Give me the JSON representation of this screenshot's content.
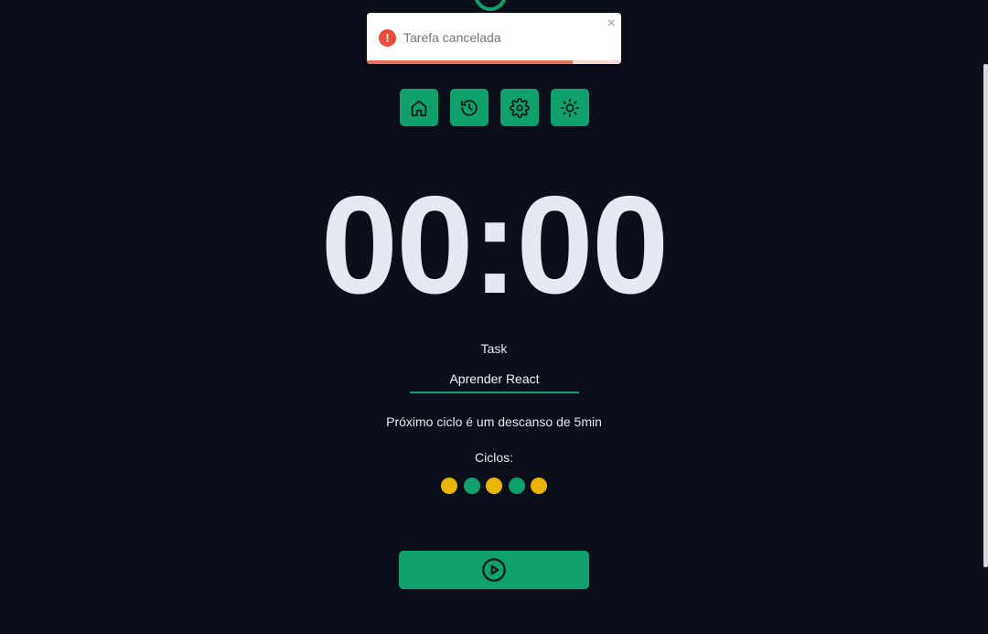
{
  "toast": {
    "message": "Tarefa cancelada",
    "close_symbol": "×",
    "icon": "error-icon",
    "icon_symbol": "!",
    "progress": 0.81,
    "color": "#e74c3c"
  },
  "nav": {
    "items": [
      {
        "name": "home",
        "icon": "home-icon"
      },
      {
        "name": "history",
        "icon": "history-icon"
      },
      {
        "name": "settings",
        "icon": "gear-icon"
      },
      {
        "name": "theme",
        "icon": "sun-icon"
      }
    ]
  },
  "timer": {
    "display": "00:00"
  },
  "task": {
    "label": "Task",
    "value": "Aprender React"
  },
  "next_cycle_text": "Próximo ciclo é um descanso de 5min",
  "cycles": {
    "label": "Ciclos:",
    "dots": [
      {
        "type": "work",
        "color": "#eab308"
      },
      {
        "type": "short-break",
        "color": "#10a06c"
      },
      {
        "type": "work",
        "color": "#eab308"
      },
      {
        "type": "short-break",
        "color": "#10a06c"
      },
      {
        "type": "work",
        "color": "#eab308"
      }
    ]
  },
  "play_button": {
    "icon": "play-circle-icon"
  },
  "colors": {
    "background": "#0b0f1a",
    "accent": "#10a06c",
    "work": "#eab308",
    "text": "#e5e7eb"
  }
}
